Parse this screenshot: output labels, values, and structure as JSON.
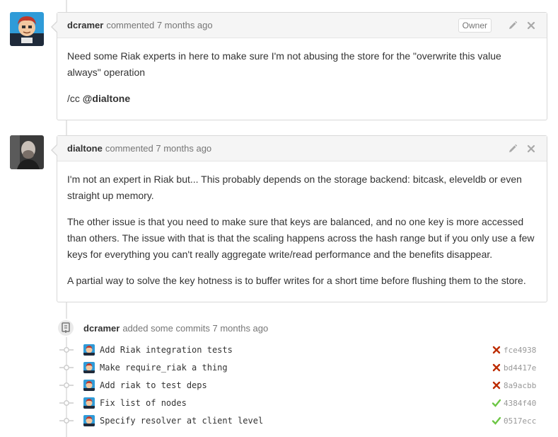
{
  "comments": [
    {
      "author": "dcramer",
      "meta": "commented 7 months ago",
      "badge": "Owner",
      "paragraphs": [
        "Need some Riak experts in here to make sure I'm not abusing the store for the \"overwrite this value always\" operation"
      ],
      "cc_prefix": "/cc ",
      "cc_mention": "@dialtone"
    },
    {
      "author": "dialtone",
      "meta": "commented 7 months ago",
      "paragraphs": [
        "I'm not an expert in Riak but... This probably depends on the storage backend: bitcask, eleveldb or even straight up memory.",
        "The other issue is that you need to make sure that keys are balanced, and no one key is more accessed than others. The issue with that is that the scaling happens across the hash range but if you only use a few keys for everything you can't really aggregate write/read performance and the benefits disappear.",
        "A partial way to solve the key hotness is to buffer writes for a short time before flushing them to the store."
      ]
    }
  ],
  "commits_event": {
    "author": "dcramer",
    "meta": "added some commits 7 months ago"
  },
  "commits": [
    {
      "message": "Add Riak integration tests",
      "status": "failure",
      "sha": "fce4938"
    },
    {
      "message": "Make require_riak a thing",
      "status": "failure",
      "sha": "bd4417e"
    },
    {
      "message": "Add riak to test deps",
      "status": "failure",
      "sha": "8a9acbb"
    },
    {
      "message": "Fix list of nodes",
      "status": "success",
      "sha": "4384f40"
    },
    {
      "message": "Specify resolver at client level",
      "status": "success",
      "sha": "0517ecc"
    }
  ],
  "colors": {
    "failure": "#bd2c00",
    "success": "#6cc644",
    "muted": "#767676"
  },
  "icons": {
    "edit": "pencil-icon",
    "delete": "close-icon",
    "commit_event": "commit-icon",
    "commit_node": "commit-node-icon"
  }
}
